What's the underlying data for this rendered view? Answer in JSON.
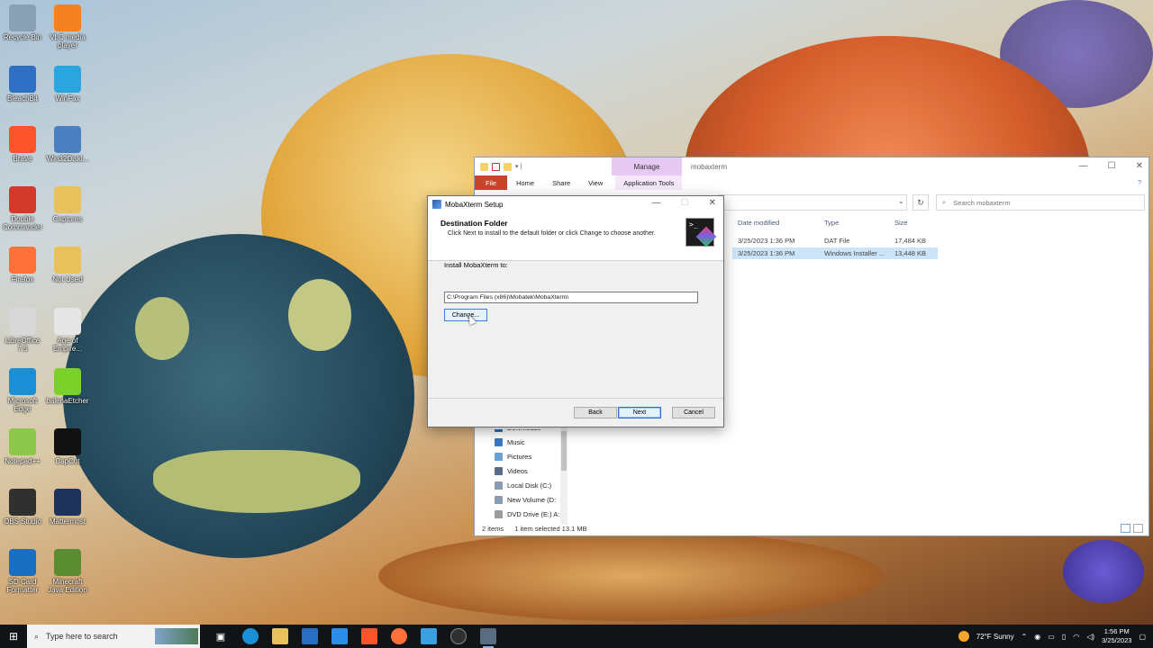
{
  "desktop": {
    "icons": [
      {
        "label": "Recycle Bin",
        "icon": "recycle-bin-icon",
        "color": "#8aa0b5"
      },
      {
        "label": "VLC media player",
        "icon": "vlc-icon",
        "color": "#f58220"
      },
      {
        "label": "BleachBit",
        "icon": "bleachbit-icon",
        "color": "#2f6fc4"
      },
      {
        "label": "WinFax",
        "icon": "winfax-icon",
        "color": "#2aa5e0"
      },
      {
        "label": "Brave",
        "icon": "brave-icon",
        "color": "#fb542b"
      },
      {
        "label": "Win32Diskl...",
        "icon": "win32diskimager-icon",
        "color": "#4a7fc1"
      },
      {
        "label": "Double Commander",
        "icon": "double-commander-icon",
        "color": "#d33a2c"
      },
      {
        "label": "Captures",
        "icon": "folder-icon",
        "color": "#e8c15a"
      },
      {
        "label": "Firefox",
        "icon": "firefox-icon",
        "color": "#ff7139"
      },
      {
        "label": "Not Used",
        "icon": "folder-icon",
        "color": "#e8c15a"
      },
      {
        "label": "LibreOffice 7.5",
        "icon": "libreoffice-icon",
        "color": "#d8d8d8"
      },
      {
        "label": "Age of Empire...",
        "icon": "document-icon",
        "color": "#e6e6e6"
      },
      {
        "label": "Microsoft Edge",
        "icon": "edge-icon",
        "color": "#1b8fd6"
      },
      {
        "label": "balenaEtcher",
        "icon": "balena-etcher-icon",
        "color": "#7bd12a"
      },
      {
        "label": "Notepad++",
        "icon": "notepadpp-icon",
        "color": "#8cc84b"
      },
      {
        "label": "CapCut",
        "icon": "capcut-icon",
        "color": "#111111"
      },
      {
        "label": "OBS Studio",
        "icon": "obs-icon",
        "color": "#303030"
      },
      {
        "label": "Mattermost",
        "icon": "mattermost-icon",
        "color": "#1e325c"
      },
      {
        "label": "SD Card Formatter",
        "icon": "sd-card-icon",
        "color": "#1a6fc0"
      },
      {
        "label": "Minecraft Java Edition",
        "icon": "minecraft-icon",
        "color": "#5b8c32"
      }
    ]
  },
  "explorer": {
    "title": "mobaxterm",
    "manage_tab": "Manage",
    "ribbon_tabs": {
      "file": "File",
      "home": "Home",
      "share": "Share",
      "view": "View",
      "app_tools": "Application Tools"
    },
    "search_placeholder": "Search mobaxterm",
    "columns": {
      "date": "Date modified",
      "type": "Type",
      "size": "Size"
    },
    "files": [
      {
        "date": "3/25/2023 1:36 PM",
        "type": "DAT File",
        "size": "17,484 KB",
        "selected": false
      },
      {
        "date": "3/25/2023 1:36 PM",
        "type": "Windows Installer ...",
        "size": "13,448 KB",
        "selected": true
      }
    ],
    "nav": [
      {
        "label": "Downloads",
        "icon": "downloads-icon"
      },
      {
        "label": "Music",
        "icon": "music-icon"
      },
      {
        "label": "Pictures",
        "icon": "pictures-icon"
      },
      {
        "label": "Videos",
        "icon": "videos-icon"
      },
      {
        "label": "Local Disk (C:)",
        "icon": "drive-icon"
      },
      {
        "label": "New Volume (D:",
        "icon": "drive-icon"
      },
      {
        "label": "DVD Drive (E:) A:",
        "icon": "dvd-icon"
      }
    ],
    "status": {
      "items": "2 items",
      "selected": "1 item selected  13.1 MB"
    }
  },
  "setup": {
    "title": "MobaXterm Setup",
    "header_title": "Destination Folder",
    "header_subtitle": "Click Next to install to the default folder or click Change to choose another.",
    "install_label": "Install MobaXterm to:",
    "path": "C:\\Program Files (x86)\\Mobatek\\MobaXterm\\",
    "change_label": "Change...",
    "back_label": "Back",
    "next_label": "Next",
    "cancel_label": "Cancel"
  },
  "taskbar": {
    "search_placeholder": "Type here to search",
    "weather": "72°F  Sunny",
    "time": "1:56 PM",
    "date": "3/25/2023"
  }
}
